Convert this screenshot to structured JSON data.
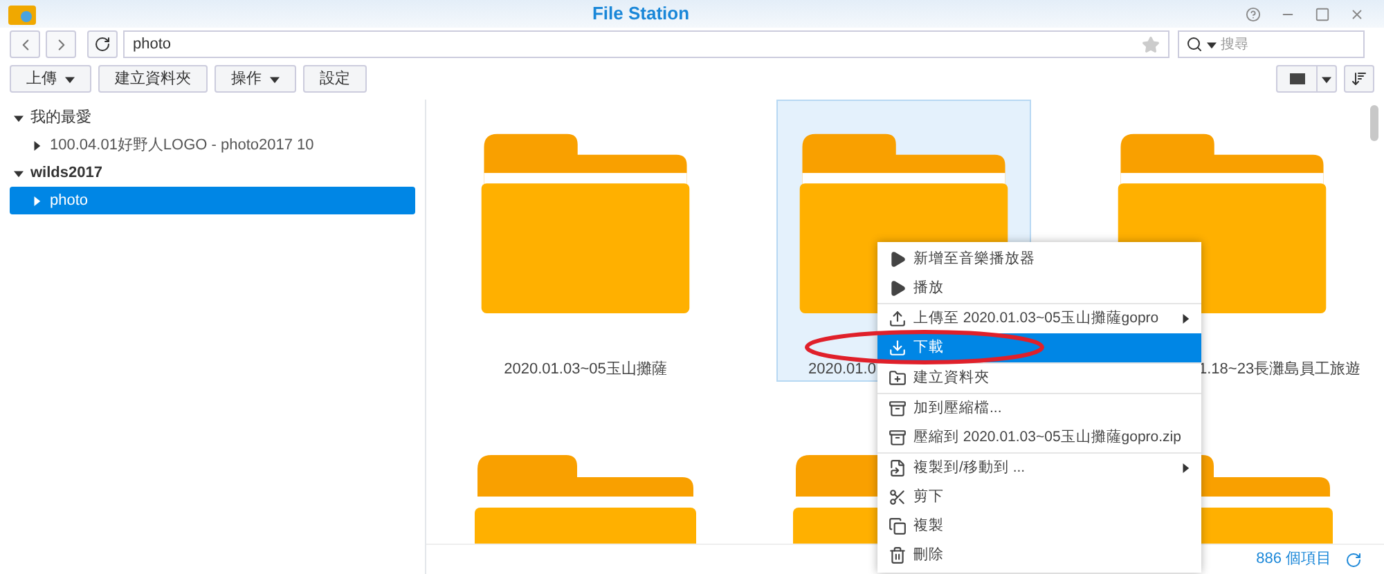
{
  "window": {
    "title": "File Station"
  },
  "path": {
    "value": "photo"
  },
  "search": {
    "placeholder": "搜尋"
  },
  "toolbar": [
    {
      "label": "上傳",
      "dropdown": true
    },
    {
      "label": "建立資料夾",
      "dropdown": false
    },
    {
      "label": "操作",
      "dropdown": true
    },
    {
      "label": "設定",
      "dropdown": false
    }
  ],
  "sidebar": [
    {
      "label": "我的最愛",
      "bold": false,
      "expanded": true,
      "selected": false,
      "children": [
        {
          "label": "100.04.01好野人LOGO - photo2017 10",
          "selected": false
        }
      ]
    },
    {
      "label": "wilds2017",
      "bold": true,
      "expanded": true,
      "selected": false,
      "children": [
        {
          "label": "photo",
          "selected": true
        }
      ]
    }
  ],
  "folders": [
    {
      "label": "2020.01.03~05玉山攤薩",
      "selected": false
    },
    {
      "label": "2020.01.0",
      "selected": true
    },
    {
      "label": "1.18~23長灘島員工旅遊",
      "selected": false
    },
    {
      "selected": false
    },
    {
      "selected": false
    },
    {
      "selected": false
    }
  ],
  "menu": {
    "groups": [
      [
        {
          "label": "新增至音樂播放器",
          "submenu": false,
          "selected": false
        },
        {
          "label": "播放",
          "submenu": false,
          "selected": false
        }
      ],
      [
        {
          "label": "上傳至 2020.01.03~05玉山攤薩gopro",
          "submenu": true,
          "selected": false
        },
        {
          "label": "下載",
          "submenu": false,
          "selected": true
        }
      ],
      [
        {
          "label": "建立資料夾",
          "submenu": false,
          "selected": false
        }
      ],
      [
        {
          "label": "加到壓縮檔...",
          "submenu": false,
          "selected": false
        },
        {
          "label": "壓縮到 2020.01.03~05玉山攤薩gopro.zip",
          "submenu": false,
          "selected": false
        }
      ],
      [
        {
          "label": "複製到/移動到 ...",
          "submenu": true,
          "selected": false
        },
        {
          "label": "剪下",
          "submenu": false,
          "selected": false
        },
        {
          "label": "複製",
          "submenu": false,
          "selected": false
        },
        {
          "label": "刪除",
          "submenu": false,
          "selected": false
        }
      ]
    ]
  },
  "status": {
    "count": "886 個項目"
  }
}
